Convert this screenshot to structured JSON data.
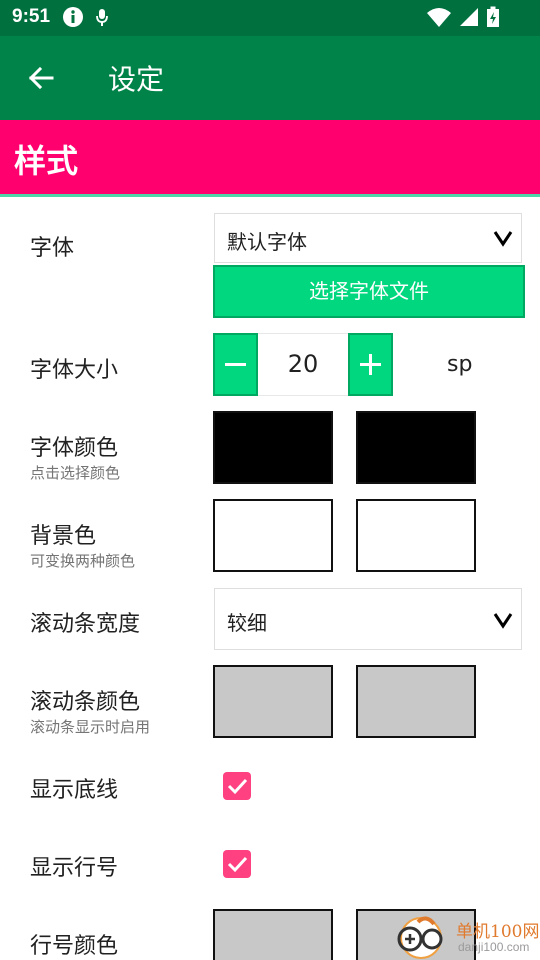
{
  "status_bar": {
    "time": "9:51"
  },
  "app_bar": {
    "title": "设定"
  },
  "section": {
    "title": "样式"
  },
  "font": {
    "label": "字体",
    "selected": "默认字体",
    "choose_file_button": "选择字体文件"
  },
  "font_size": {
    "label": "字体大小",
    "value": "20",
    "unit": "sp"
  },
  "font_color": {
    "label": "字体颜色",
    "hint": "点击选择颜色",
    "colors": [
      "#000000",
      "#000000"
    ]
  },
  "background_color": {
    "label": "背景色",
    "hint": "可变换两种颜色",
    "colors": [
      "#ffffff",
      "#ffffff"
    ]
  },
  "scrollbar_width": {
    "label": "滚动条宽度",
    "selected": "较细"
  },
  "scrollbar_color": {
    "label": "滚动条颜色",
    "hint": "滚动条显示时启用",
    "colors": [
      "#c8c8c8",
      "#c8c8c8"
    ]
  },
  "show_underline": {
    "label": "显示底线",
    "checked": true
  },
  "show_line_numbers": {
    "label": "显示行号",
    "checked": true
  },
  "line_number_color": {
    "label": "行号颜色",
    "colors": [
      "#c8c8c8",
      "#c8c8c8"
    ]
  },
  "watermark": {
    "brand": "单机100网",
    "url": "danji100.com"
  },
  "theme": {
    "status_bar": "#00703f",
    "app_bar": "#008349",
    "section": "#ff006e",
    "accent": "#00d77f",
    "checkbox": "#ff4081"
  }
}
